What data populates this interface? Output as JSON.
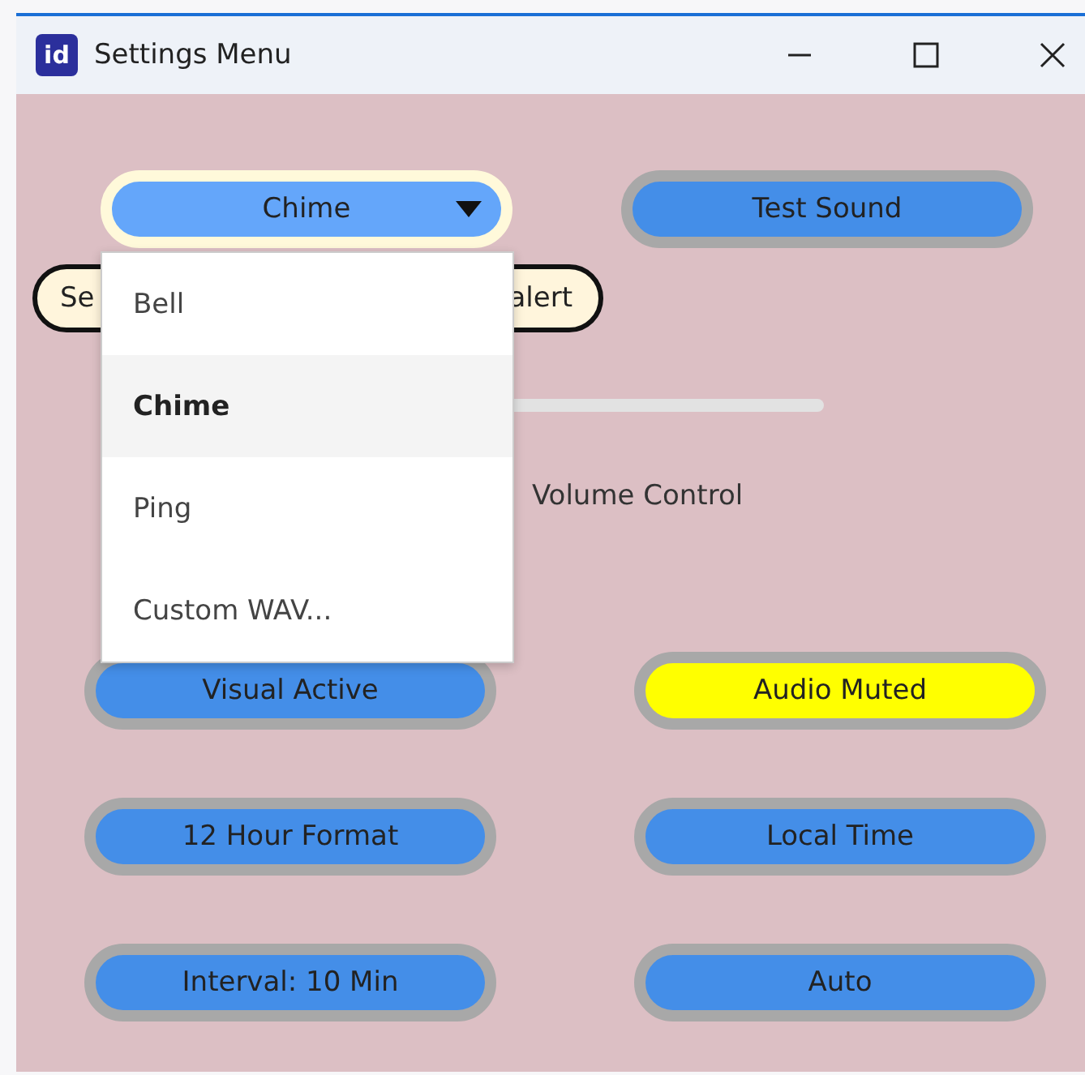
{
  "window": {
    "title": "Settings Menu",
    "app_icon_text": "id"
  },
  "sound_select": {
    "value": "Chime",
    "expanded": true,
    "options": [
      {
        "label": "Bell",
        "selected": false
      },
      {
        "label": "Chime",
        "selected": true
      },
      {
        "label": "Ping",
        "selected": false
      },
      {
        "label": "Custom WAV...",
        "selected": false
      }
    ]
  },
  "test_button": "Test Sound",
  "alert_chip": {
    "text_start": "Se",
    "text_end": "alert"
  },
  "volume": {
    "label": "Volume Control"
  },
  "toggles": [
    {
      "label": "Visual Active",
      "kind": "normal"
    },
    {
      "label": "Audio Muted",
      "kind": "highlight"
    },
    {
      "label": "12 Hour Format",
      "kind": "normal"
    },
    {
      "label": "Local Time",
      "kind": "normal"
    },
    {
      "label": "Interval: 10 Min",
      "kind": "normal"
    },
    {
      "label": "Auto",
      "kind": "normal"
    }
  ]
}
